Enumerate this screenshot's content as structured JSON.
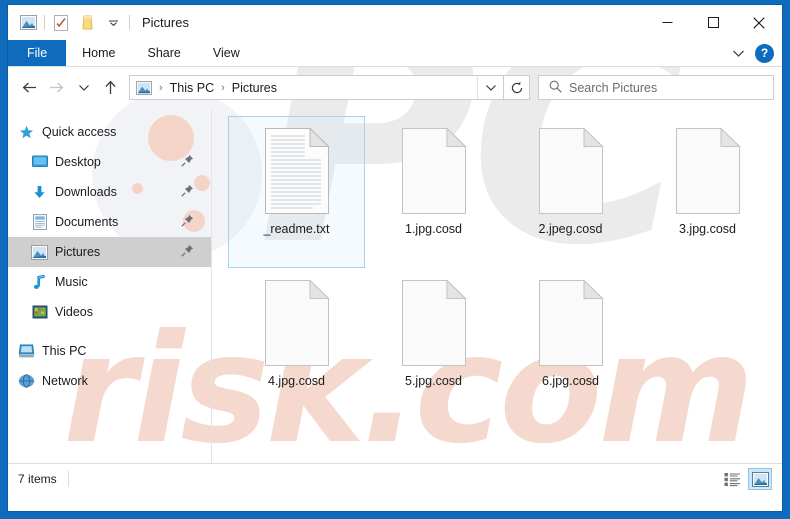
{
  "window": {
    "title": "Pictures",
    "quick_access_toolbar": [
      {
        "name": "pictures-icon",
        "tooltip": "Pictures"
      },
      {
        "name": "properties-icon",
        "tooltip": "Properties"
      },
      {
        "name": "new-folder-icon",
        "tooltip": "New folder"
      },
      {
        "name": "chevron-down-icon",
        "tooltip": "Customize Quick Access Toolbar"
      }
    ],
    "controls": {
      "minimize": "─",
      "maximize": "☐",
      "close": "✕"
    }
  },
  "ribbon": {
    "tabs": [
      {
        "label": "File",
        "active_style": "file"
      },
      {
        "label": "Home",
        "active_style": "normal"
      },
      {
        "label": "Share",
        "active_style": "normal"
      },
      {
        "label": "View",
        "active_style": "normal"
      }
    ],
    "expand_icon": "chevron-down-icon",
    "help_label": "?"
  },
  "address_bar": {
    "back": "←",
    "forward": "→",
    "recent": "⌄",
    "up": "↑",
    "breadcrumbs": [
      {
        "label": "This PC"
      },
      {
        "label": "Pictures"
      }
    ],
    "separator": "›",
    "dropdown_icon": "chevron-down-icon",
    "refresh_icon": "refresh-icon"
  },
  "search": {
    "placeholder": "Search Pictures",
    "icon": "search-icon"
  },
  "sidebar": {
    "items": [
      {
        "label": "Quick access",
        "icon": "star-icon",
        "pinned": false,
        "selected": false,
        "root": true
      },
      {
        "label": "Desktop",
        "icon": "desktop-icon",
        "pinned": true,
        "selected": false,
        "root": false
      },
      {
        "label": "Downloads",
        "icon": "download-icon",
        "pinned": true,
        "selected": false,
        "root": false
      },
      {
        "label": "Documents",
        "icon": "documents-icon",
        "pinned": true,
        "selected": false,
        "root": false
      },
      {
        "label": "Pictures",
        "icon": "pictures-icon",
        "pinned": true,
        "selected": true,
        "root": false
      },
      {
        "label": "Music",
        "icon": "music-note-icon",
        "pinned": false,
        "selected": false,
        "root": false
      },
      {
        "label": "Videos",
        "icon": "videos-icon",
        "pinned": false,
        "selected": false,
        "root": false
      },
      {
        "label": "This PC",
        "icon": "this-pc-icon",
        "pinned": false,
        "selected": false,
        "root": true
      },
      {
        "label": "Network",
        "icon": "network-icon",
        "pinned": false,
        "selected": false,
        "root": true
      }
    ]
  },
  "files": [
    {
      "name": "_readme.txt",
      "icon": "text-document-icon",
      "selected": true
    },
    {
      "name": "1.jpg.cosd",
      "icon": "blank-document-icon",
      "selected": false
    },
    {
      "name": "2.jpeg.cosd",
      "icon": "blank-document-icon",
      "selected": false
    },
    {
      "name": "3.jpg.cosd",
      "icon": "blank-document-icon",
      "selected": false
    },
    {
      "name": "4.jpg.cosd",
      "icon": "blank-document-icon",
      "selected": false
    },
    {
      "name": "5.jpg.cosd",
      "icon": "blank-document-icon",
      "selected": false
    },
    {
      "name": "6.jpg.cosd",
      "icon": "blank-document-icon",
      "selected": false
    }
  ],
  "status_bar": {
    "item_count": "7 items",
    "view_buttons": [
      {
        "name": "details-view-button",
        "active": false
      },
      {
        "name": "large-icons-view-button",
        "active": true
      }
    ]
  },
  "watermark": {
    "primary": "PC",
    "secondary": "risk.com"
  },
  "colors": {
    "accent": "#0f6cbd",
    "frame": "#0b5ca8",
    "selection_border": "#a5d3f0",
    "sidebar_selection": "#cfcfcf",
    "watermark_grey": "#dcdcdc",
    "watermark_peach": "#f4cdbe"
  }
}
